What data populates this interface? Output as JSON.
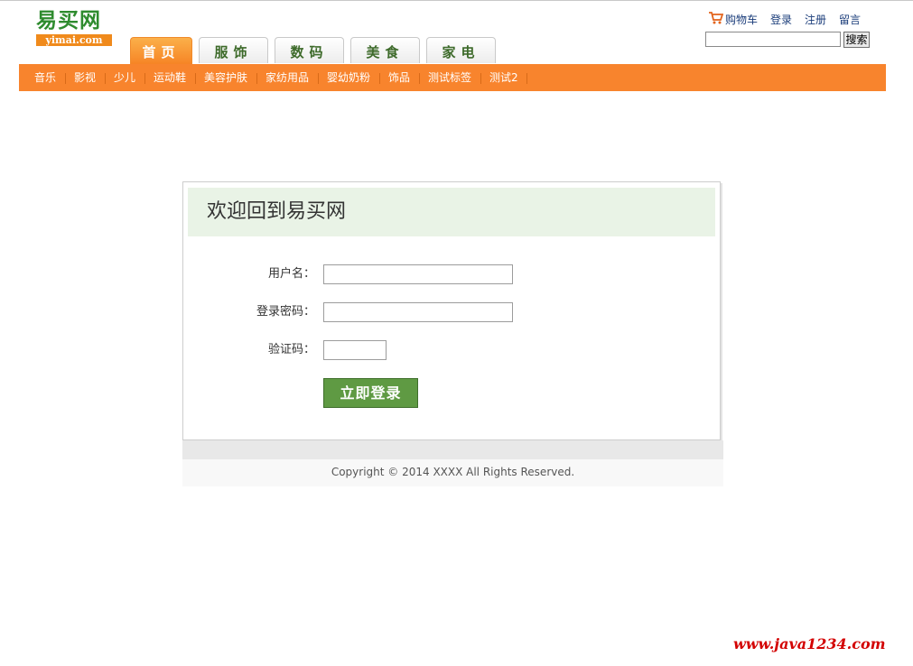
{
  "header": {
    "logo_cn": "易买网",
    "logo_en": "yimai.com",
    "tabs": [
      {
        "label": "首页"
      },
      {
        "label": "服饰"
      },
      {
        "label": "数码"
      },
      {
        "label": "美食"
      },
      {
        "label": "家电"
      }
    ],
    "links": {
      "cart": "购物车",
      "login": "登录",
      "register": "注册",
      "message": "留言"
    },
    "search": {
      "value": "",
      "button_label": "搜索"
    }
  },
  "categories": [
    "音乐",
    "影视",
    "少儿",
    "运动鞋",
    "美容护肤",
    "家纺用品",
    "婴幼奶粉",
    "饰品",
    "测试标签",
    "测试2"
  ],
  "login": {
    "title": "欢迎回到易买网",
    "username_label": "用户名：",
    "password_label": "登录密码：",
    "captcha_label": "验证码：",
    "username_value": "",
    "password_value": "",
    "captcha_value": "",
    "submit_label": "立即登录"
  },
  "footer": {
    "copyright": "Copyright © 2014 XXXX All Rights Reserved."
  },
  "watermark": "www.java1234.com",
  "colors": {
    "accent_orange": "#f8842d",
    "brand_green": "#2e8b2e",
    "button_green": "#5f9a43",
    "login_header_bg": "#e9f3e6",
    "watermark_red": "#d30000"
  }
}
